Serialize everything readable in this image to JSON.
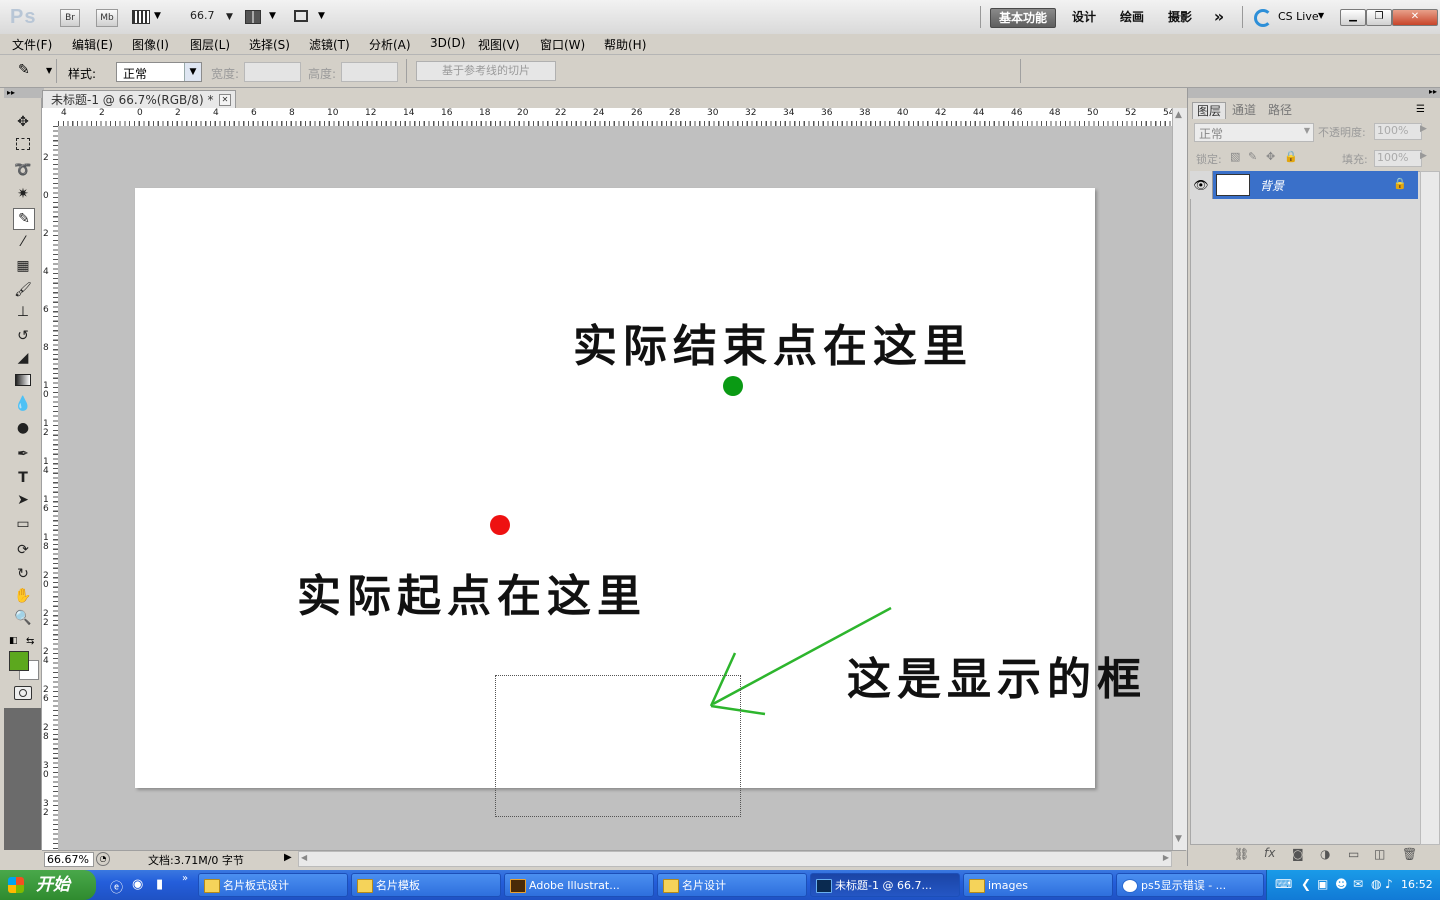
{
  "titlebar": {
    "logo": "Ps",
    "br": "Br",
    "mb": "Mb",
    "zoom": "66.7",
    "workspaces": [
      "基本功能",
      "设计",
      "绘画",
      "摄影"
    ],
    "more": "»",
    "cs_live": "CS Live"
  },
  "menu": [
    "文件(F)",
    "编辑(E)",
    "图像(I)",
    "图层(L)",
    "选择(S)",
    "滤镜(T)",
    "分析(A)",
    "3D(D)",
    "视图(V)",
    "窗口(W)",
    "帮助(H)"
  ],
  "options": {
    "style_label": "样式:",
    "style_value": "正常",
    "width_label": "宽度:",
    "height_label": "高度:",
    "slice_button": "基于参考线的切片"
  },
  "document": {
    "tab_title": "未标题-1 @ 66.7%(RGB/8) *",
    "hruler_labels": [
      "4",
      "2",
      "0",
      "2",
      "4",
      "6",
      "8",
      "10",
      "12",
      "14",
      "16",
      "18",
      "20",
      "22",
      "24",
      "26",
      "28",
      "30",
      "32",
      "34",
      "36",
      "38",
      "40",
      "42",
      "44",
      "46",
      "48",
      "50",
      "52",
      "54"
    ],
    "vruler_labels": [
      "2",
      "0",
      "2",
      "4",
      "6",
      "8",
      "10",
      "12",
      "14",
      "16",
      "18",
      "20",
      "22",
      "24",
      "26",
      "28",
      "30",
      "32"
    ],
    "annotation_end": "实际结束点在这里",
    "annotation_start": "实际起点在这里",
    "annotation_box": "这是显示的框",
    "colors": {
      "end_dot": "#0a9a14",
      "start_dot": "#ee1111",
      "arrow": "#2db52d"
    }
  },
  "status": {
    "zoom": "66.67%",
    "doc_info": "文档:3.71M/0 字节"
  },
  "layers_panel": {
    "tabs": [
      "图层",
      "通道",
      "路径"
    ],
    "blend_mode": "正常",
    "opacity_label": "不透明度:",
    "opacity_value": "100%",
    "lock_label": "锁定:",
    "fill_label": "填充:",
    "fill_value": "100%",
    "layer_name": "背景"
  },
  "taskbar": {
    "start": "开始",
    "items": [
      "名片板式设计",
      "名片模板",
      "Adobe Illustrat...",
      "名片设计",
      "未标题-1 @ 66.7...",
      "images",
      "ps5显示错误 - ..."
    ],
    "clock": "16:52"
  },
  "swatch": {
    "foreground": "#5ca81e",
    "background": "#ffffff"
  }
}
